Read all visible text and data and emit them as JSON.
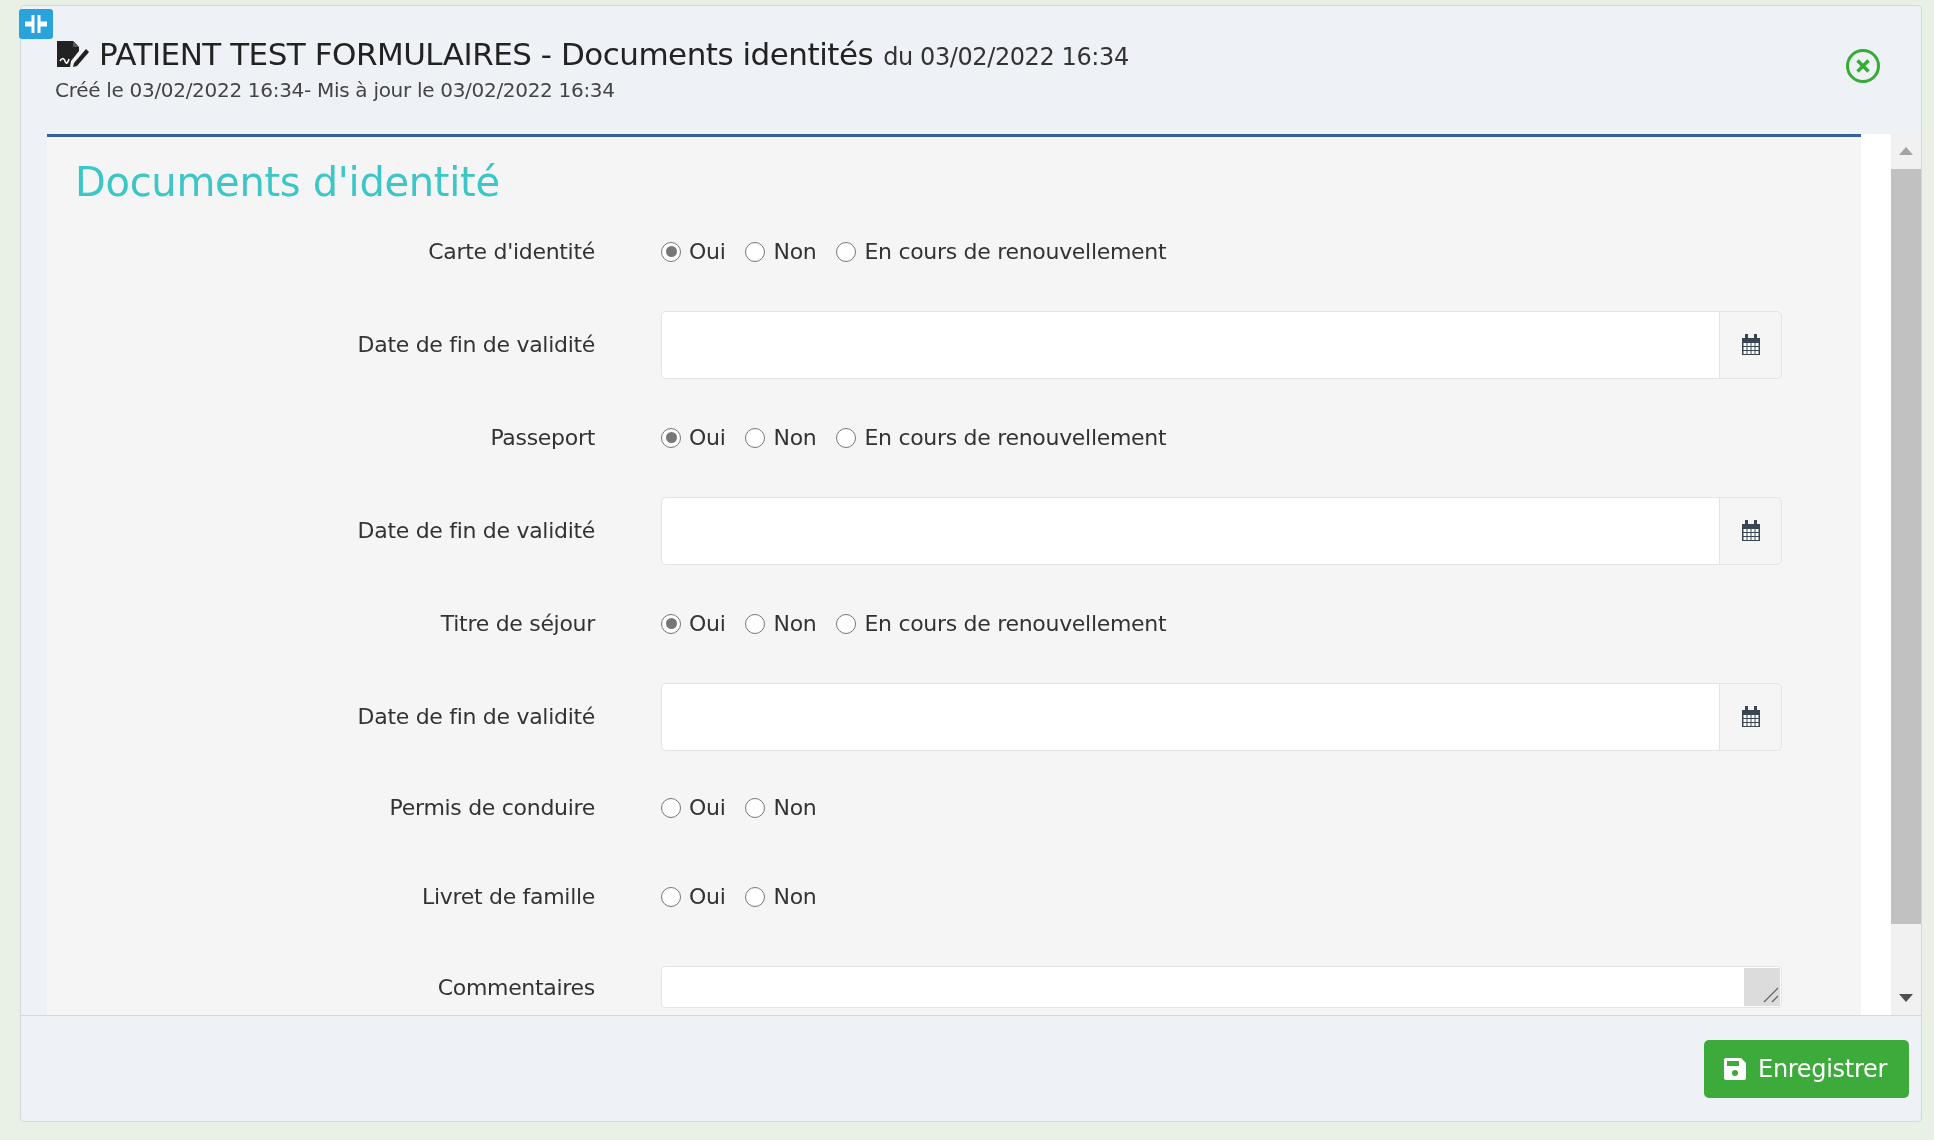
{
  "header": {
    "title": "PATIENT TEST FORMULAIRES - Documents identités",
    "date": "du 03/02/2022 16:34",
    "subtitle": "Créé le 03/02/2022 16:34- Mis à jour le 03/02/2022 16:34"
  },
  "form": {
    "heading": "Documents d'identité",
    "rows": [
      {
        "kind": "radio",
        "label": "Carte d'identité",
        "options": [
          {
            "label": "Oui",
            "selected": true
          },
          {
            "label": "Non",
            "selected": false
          },
          {
            "label": "En cours de renouvellement",
            "selected": false
          }
        ]
      },
      {
        "kind": "date",
        "label": "Date de fin de validité"
      },
      {
        "kind": "radio",
        "label": "Passeport",
        "options": [
          {
            "label": "Oui",
            "selected": true
          },
          {
            "label": "Non",
            "selected": false
          },
          {
            "label": "En cours de renouvellement",
            "selected": false
          }
        ]
      },
      {
        "kind": "date",
        "label": "Date de fin de validité"
      },
      {
        "kind": "radio",
        "label": "Titre de séjour",
        "options": [
          {
            "label": "Oui",
            "selected": true
          },
          {
            "label": "Non",
            "selected": false
          },
          {
            "label": "En cours de renouvellement",
            "selected": false
          }
        ]
      },
      {
        "kind": "date",
        "label": "Date de fin de validité"
      },
      {
        "kind": "radio",
        "label": "Permis de conduire",
        "options": [
          {
            "label": "Oui",
            "selected": false
          },
          {
            "label": "Non",
            "selected": false
          }
        ]
      },
      {
        "kind": "radio",
        "label": "Livret de famille",
        "options": [
          {
            "label": "Oui",
            "selected": false
          },
          {
            "label": "Non",
            "selected": false
          }
        ]
      },
      {
        "kind": "textarea",
        "label": "Commentaires"
      }
    ]
  },
  "footer": {
    "save_button": "Enregistrer"
  }
}
